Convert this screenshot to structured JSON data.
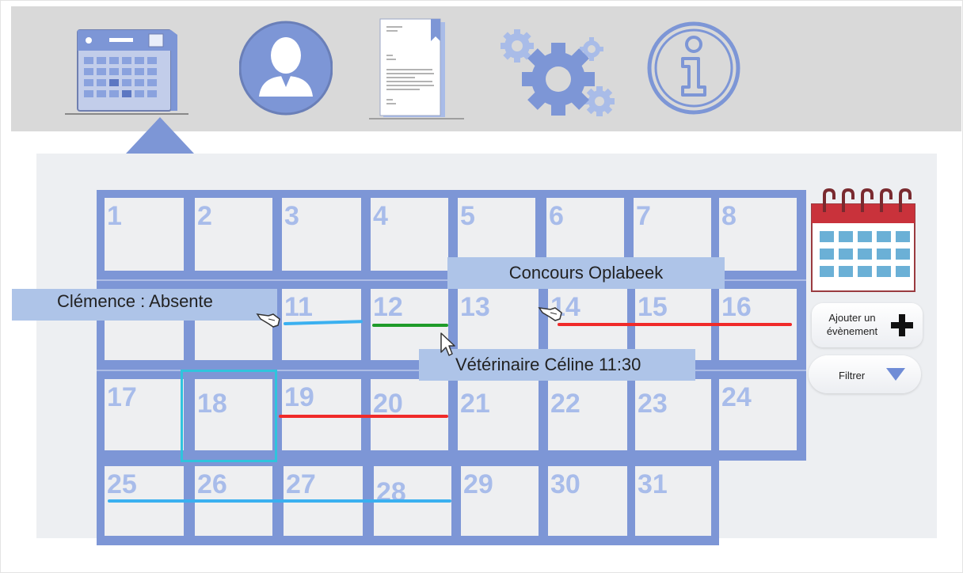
{
  "nav": [
    {
      "name": "calendar-nav-icon",
      "active": true
    },
    {
      "name": "user-profile-icon",
      "active": false
    },
    {
      "name": "document-icon",
      "active": false
    },
    {
      "name": "settings-gears-icon",
      "active": false
    },
    {
      "name": "info-icon",
      "active": false
    }
  ],
  "calendar": {
    "days": [
      "1",
      "2",
      "3",
      "4",
      "5",
      "6",
      "7",
      "8",
      "11",
      "12",
      "13",
      "14",
      "15",
      "16",
      "17",
      "18",
      "19",
      "20",
      "21",
      "22",
      "23",
      "24",
      "25",
      "26",
      "27",
      "28",
      "29",
      "30",
      "31"
    ],
    "selected_day": "18"
  },
  "events": {
    "concours": "Concours Oplabeek",
    "absence": "Clémence : Absente",
    "veterinaire": "Vétérinaire Céline 11:30"
  },
  "sidebar": {
    "add_event_label_line1": "Ajouter un",
    "add_event_label_line2": "évènement",
    "filter_label": "Filtrer"
  },
  "colors": {
    "accent": "#7d96d6",
    "grid_blue": "#7d96d6",
    "day_number": "#a8bcea",
    "event_label_bg": "#aec4e8",
    "line_blue": "#3ab0f0",
    "line_green": "#1f9b2a",
    "line_red": "#f02a2a",
    "selection": "#2fc4dd",
    "calendar_red": "#c9323b"
  }
}
